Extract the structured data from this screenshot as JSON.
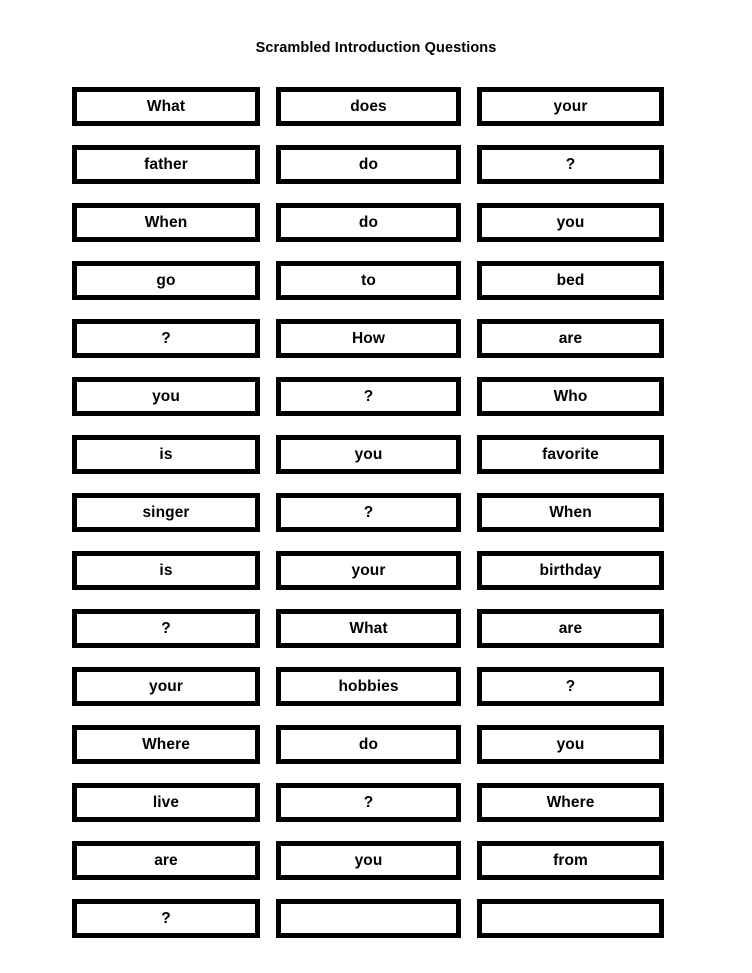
{
  "document": {
    "title": "Scrambled Introduction Questions",
    "background_color": "#ffffff",
    "text_color": "#000000",
    "card_border_color": "#000000",
    "card_fill_color": "#ffffff"
  },
  "grid": {
    "columns": 3,
    "rows": 15,
    "cells": [
      [
        "What",
        "does",
        "your"
      ],
      [
        "father",
        "do",
        "?"
      ],
      [
        "When",
        "do",
        "you"
      ],
      [
        "go",
        "to",
        "bed"
      ],
      [
        "?",
        "How",
        "are"
      ],
      [
        "you",
        "?",
        "Who"
      ],
      [
        "is",
        "you",
        "favorite"
      ],
      [
        "singer",
        "?",
        "When"
      ],
      [
        "is",
        "your",
        "birthday"
      ],
      [
        "?",
        "What",
        "are"
      ],
      [
        "your",
        "hobbies",
        "?"
      ],
      [
        "Where",
        "do",
        "you"
      ],
      [
        "live",
        "?",
        "Where"
      ],
      [
        "are",
        "you",
        "from"
      ],
      [
        "?",
        "",
        ""
      ]
    ]
  }
}
